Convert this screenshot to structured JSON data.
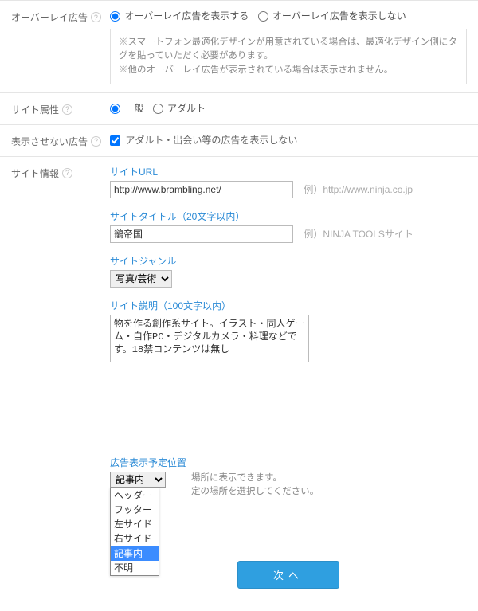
{
  "overlay": {
    "label": "オーバーレイ広告",
    "show": "オーバーレイ広告を表示する",
    "hide": "オーバーレイ広告を表示しない",
    "note1": "※スマートフォン最適化デザインが用意されている場合は、最適化デザイン側にタグを貼っていただく必要があります。",
    "note2": "※他のオーバーレイ広告が表示されている場合は表示されません。"
  },
  "attr": {
    "label": "サイト属性",
    "general": "一般",
    "adult": "アダルト"
  },
  "hideAds": {
    "label": "表示させない広告",
    "checkbox": "アダルト・出会い等の広告を表示しない"
  },
  "siteInfo": {
    "label": "サイト情報",
    "url": {
      "label": "サイトURL",
      "value": "http://www.brambling.net/",
      "example": "例）http://www.ninja.co.jp"
    },
    "title": {
      "label": "サイトタイトル（20文字以内）",
      "value": "鶲帝国",
      "example": "例）NINJA TOOLSサイト"
    },
    "genre": {
      "label": "サイトジャンル",
      "value": "写真/芸術"
    },
    "desc": {
      "label": "サイト説明（100文字以内）",
      "value": "物を作る創作系サイト。イラスト・同人ゲーム・自作PC・デジタルカメラ・料理などです。18禁コンテンツは無し"
    },
    "position": {
      "label": "広告表示予定位置",
      "value": "記事内",
      "options": [
        "ヘッダー",
        "フッター",
        "左サイド",
        "右サイド",
        "記事内",
        "不明"
      ],
      "help1": "場所に表示できます。",
      "help2": "定の場所を選択してください。"
    }
  },
  "submit": "次へ"
}
